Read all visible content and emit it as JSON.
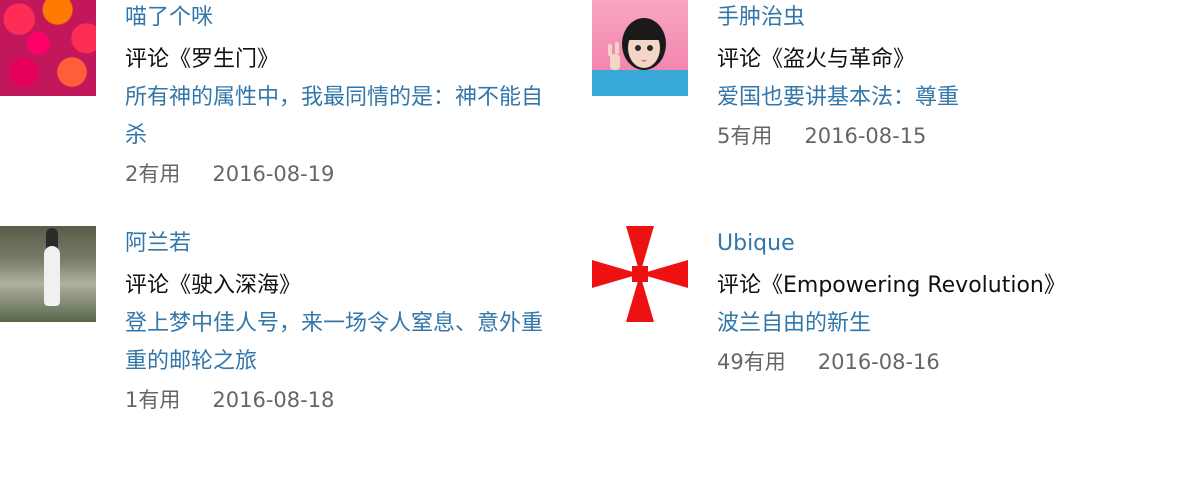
{
  "reviews": [
    {
      "username": "喵了个咪",
      "subject": "评论《罗生门》",
      "summary": "所有神的属性中，我最同情的是：神不能自杀",
      "useful": "2有用",
      "date": "2016-08-19",
      "avatar": "flowers-avatar"
    },
    {
      "username": "手肿治虫",
      "subject": "评论《盗火与革命》",
      "summary": "爱国也要讲基本法：尊重",
      "useful": "5有用",
      "date": "2016-08-15",
      "avatar": "girl-avatar"
    },
    {
      "username": "阿兰若",
      "subject": "评论《驶入深海》",
      "summary": "登上梦中佳人号，来一场令人窒息、意外重重的邮轮之旅",
      "useful": "1有用",
      "date": "2016-08-18",
      "avatar": "photo-avatar"
    },
    {
      "username": "Ubique",
      "subject": "评论《Empowering Revolution》",
      "summary": "波兰自由的新生",
      "useful": "49有用",
      "date": "2016-08-16",
      "avatar": "red-cross-avatar"
    }
  ],
  "colors": {
    "link": "#3377aa",
    "text": "#111111",
    "meta": "#666666",
    "cross": "#ee1111"
  }
}
